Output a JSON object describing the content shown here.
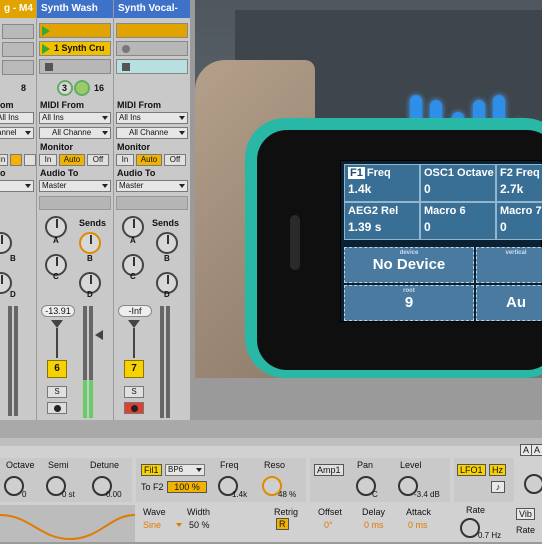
{
  "tracks": [
    {
      "name": "g - M4",
      "color": "#e0a300"
    },
    {
      "name": "Synth Wash",
      "color": "#3d72c8"
    },
    {
      "name": "Synth Vocal-",
      "color": "#3d72c8"
    }
  ],
  "clip_name": "1 Synth Cru",
  "io": {
    "numbers": [
      "8",
      "3",
      "16"
    ],
    "midi_from_label": "MIDI From",
    "midi_from_value": "All Ins",
    "channel_value": "All Channe",
    "monitor_label": "Monitor",
    "monitor_options": [
      "In",
      "Auto",
      "Off"
    ],
    "audio_to_label": "Audio To",
    "audio_to_value": "Master",
    "left_frag": [
      "om",
      "annel",
      "to",
      "o"
    ]
  },
  "sends": {
    "label": "Sends",
    "letters": [
      "A",
      "B",
      "C",
      "D"
    ]
  },
  "mixer": {
    "track6": {
      "volume": "-13.91",
      "number": "6",
      "solo": "S"
    },
    "track7": {
      "volume": "-Inf",
      "number": "7",
      "solo": "S"
    }
  },
  "phone": {
    "params": [
      {
        "tag": "F1",
        "name": "Freq",
        "value": "1.4k"
      },
      {
        "name": "OSC1 Octave",
        "value": "0"
      },
      {
        "name": "F2 Freq",
        "value": "2.7k"
      },
      {
        "name": "AEG2 Rel",
        "value": "1.39 s"
      },
      {
        "name": "Macro 6",
        "value": "0"
      },
      {
        "name": "Macro 7",
        "value": "0"
      }
    ],
    "device_small": "device",
    "device_big": "No Device",
    "vertical_small": "vertical",
    "root_small": "root",
    "root_value": "9",
    "right_value": "Au"
  },
  "device": {
    "osc": {
      "octave_label": "Octave",
      "octave_val": "0",
      "semi_label": "Semi",
      "semi_val": "0 st",
      "detune_label": "Detune",
      "detune_val": "0.00"
    },
    "filter": {
      "fil1": "Fil1",
      "type": "BP6",
      "tof2": "To F2",
      "pct": "100 %",
      "freq_label": "Freq",
      "freq_val": "1.4k",
      "reso_label": "Reso",
      "reso_val": "48 %"
    },
    "amp": {
      "amp1": "Amp1",
      "pan_label": "Pan",
      "pan_val": "C",
      "level_label": "Level",
      "level_val": "-3.4 dB"
    },
    "lfo": {
      "lfo1": "LFO1",
      "hz": "Hz",
      "wave_label": "Wave",
      "wave_val": "Sine",
      "width_label": "Width",
      "width_val": "50 %",
      "retrig_label": "Retrig",
      "retrig_btn": "R",
      "offset_label": "Offset",
      "offset_val": "0°",
      "delay_label": "Delay",
      "delay_val": "0 ms",
      "attack_label": "Attack",
      "attack_val": "0 ms",
      "rate_label": "Rate",
      "rate_val": "0.7 Hz"
    },
    "right": {
      "a": "A",
      "vib": "Vib",
      "rate": "Rate"
    }
  }
}
